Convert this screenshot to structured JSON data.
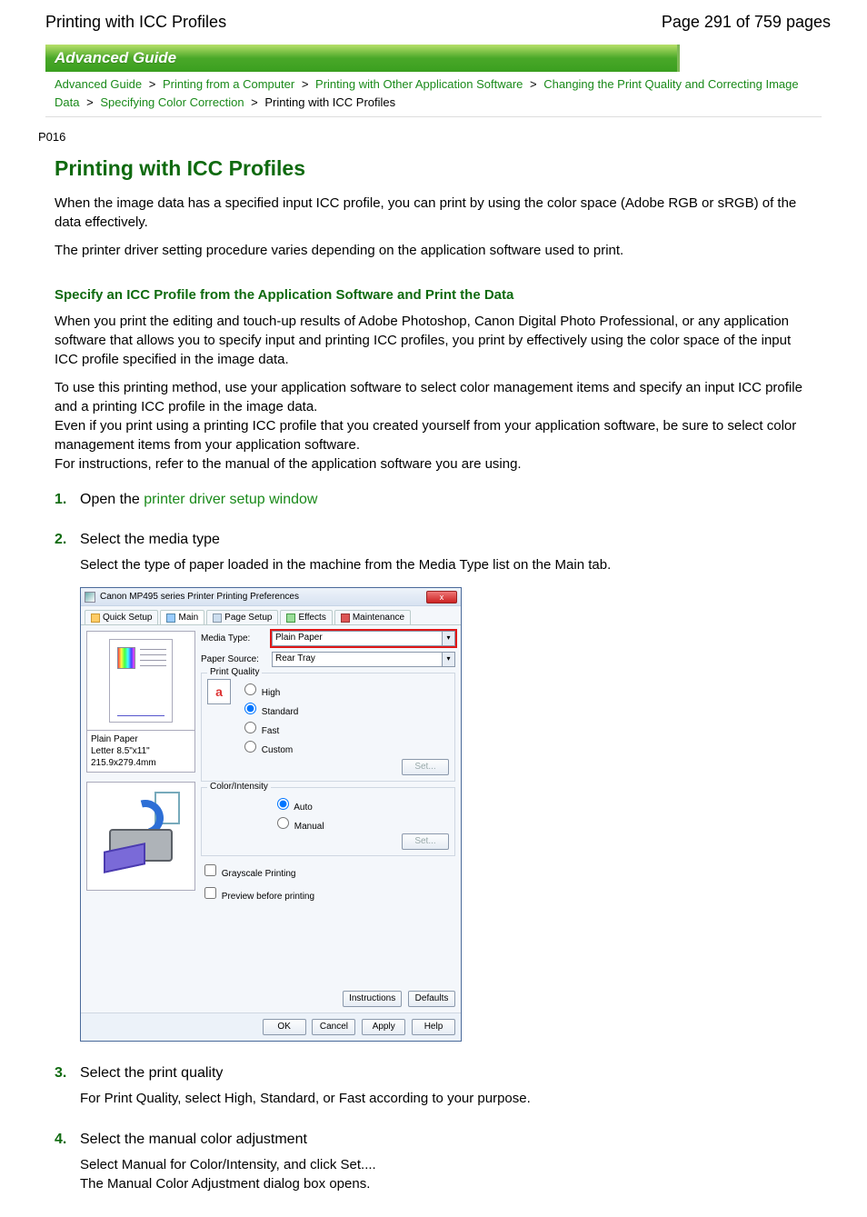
{
  "header": {
    "title": "Printing with ICC Profiles",
    "page_indicator": "Page 291 of 759 pages"
  },
  "banner": "Advanced Guide",
  "breadcrumb": {
    "items": [
      "Advanced Guide",
      "Printing from a Computer",
      "Printing with Other Application Software",
      "Changing the Print Quality and Correcting Image Data",
      "Specifying Color Correction"
    ],
    "current": "Printing with ICC Profiles",
    "sep": ">"
  },
  "ref": "P016",
  "h1": "Printing with ICC Profiles",
  "intro": [
    "When the image data has a specified input ICC profile, you can print by using the color space (Adobe RGB or sRGB) of the data effectively.",
    "The printer driver setting procedure varies depending on the application software used to print."
  ],
  "section1": {
    "heading": "Specify an ICC Profile from the Application Software and Print the Data",
    "paras": [
      "When you print the editing and touch-up results of Adobe Photoshop, Canon Digital Photo Professional, or any application software that allows you to specify input and printing ICC profiles, you print by effectively using the color space of the input ICC profile specified in the image data.",
      "To use this printing method, use your application software to select color management items and specify an input ICC profile and a printing ICC profile in the image data.\nEven if you print using a printing ICC profile that you created yourself from your application software, be sure to select color management items from your application software.\nFor instructions, refer to the manual of the application software you are using."
    ]
  },
  "steps": [
    {
      "num": "1.",
      "title_pre": "Open the ",
      "title_link": "printer driver setup window",
      "body": []
    },
    {
      "num": "2.",
      "title": "Select the media type",
      "body": [
        "Select the type of paper loaded in the machine from the Media Type list on the Main tab."
      ]
    },
    {
      "num": "3.",
      "title": "Select the print quality",
      "body": [
        "For Print Quality, select High, Standard, or Fast according to your purpose."
      ]
    },
    {
      "num": "4.",
      "title": "Select the manual color adjustment",
      "body": [
        "Select Manual for Color/Intensity, and click Set....",
        "The Manual Color Adjustment dialog box opens."
      ]
    }
  ],
  "dialog": {
    "title": "Canon MP495 series Printer Printing Preferences",
    "close": "x",
    "tabs": [
      "Quick Setup",
      "Main",
      "Page Setup",
      "Effects",
      "Maintenance"
    ],
    "active_tab": 1,
    "media_type": {
      "label": "Media Type:",
      "value": "Plain Paper"
    },
    "paper_source": {
      "label": "Paper Source:",
      "value": "Rear Tray"
    },
    "print_quality": {
      "label": "Print Quality",
      "thumb": "a",
      "options": [
        "High",
        "Standard",
        "Fast",
        "Custom"
      ],
      "selected": "Standard",
      "set": "Set..."
    },
    "color_intensity": {
      "label": "Color/Intensity",
      "options": [
        "Auto",
        "Manual"
      ],
      "selected": "Auto",
      "set": "Set..."
    },
    "grayscale": "Grayscale Printing",
    "preview_before": "Preview before printing",
    "paper_info": {
      "l1": "Plain Paper",
      "l2": "Letter 8.5\"x11\" 215.9x279.4mm"
    },
    "upper_buttons": [
      "Instructions",
      "Defaults"
    ],
    "footer_buttons": [
      "OK",
      "Cancel",
      "Apply",
      "Help"
    ]
  }
}
